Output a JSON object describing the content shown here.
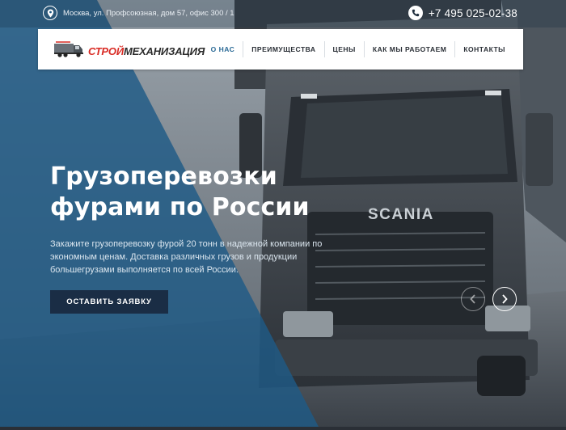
{
  "topbar": {
    "address": "Москва, ул. Профсоюзная, дом 57, офис 300 / 1",
    "address_icon": "location-pin-icon",
    "phone": "+7 495 025-02-38",
    "phone_icon": "phone-handset-icon"
  },
  "logo": {
    "part1": "СТРОЙ",
    "part2": "МЕХАНИЗАЦИЯ",
    "icon": "truck-logo-icon"
  },
  "nav": {
    "items": [
      {
        "label": "О НАС",
        "active": true
      },
      {
        "label": "ПРЕИМУЩЕСТВА",
        "active": false
      },
      {
        "label": "ЦЕНЫ",
        "active": false
      },
      {
        "label": "КАК МЫ РАБОТАЕМ",
        "active": false
      },
      {
        "label": "КОНТАКТЫ",
        "active": false
      }
    ]
  },
  "hero": {
    "title": "Грузоперевозки фурами по России",
    "description": "Закажите грузоперевозку фурой 20 тонн в надежной компании по экономным ценам. Доставка различных грузов и продукции большегрузами выполняется по всей России.",
    "cta_label": "ОСТАВИТЬ ЗАЯВКУ",
    "truck_brand": "SCANIA"
  },
  "slider": {
    "prev_icon": "chevron-left-icon",
    "next_icon": "chevron-right-icon"
  },
  "colors": {
    "accent_blue": "#2b6a96",
    "overlay_blue": "#1f5a86",
    "cta_bg": "#1a2d45",
    "logo_red": "#d92b24"
  }
}
